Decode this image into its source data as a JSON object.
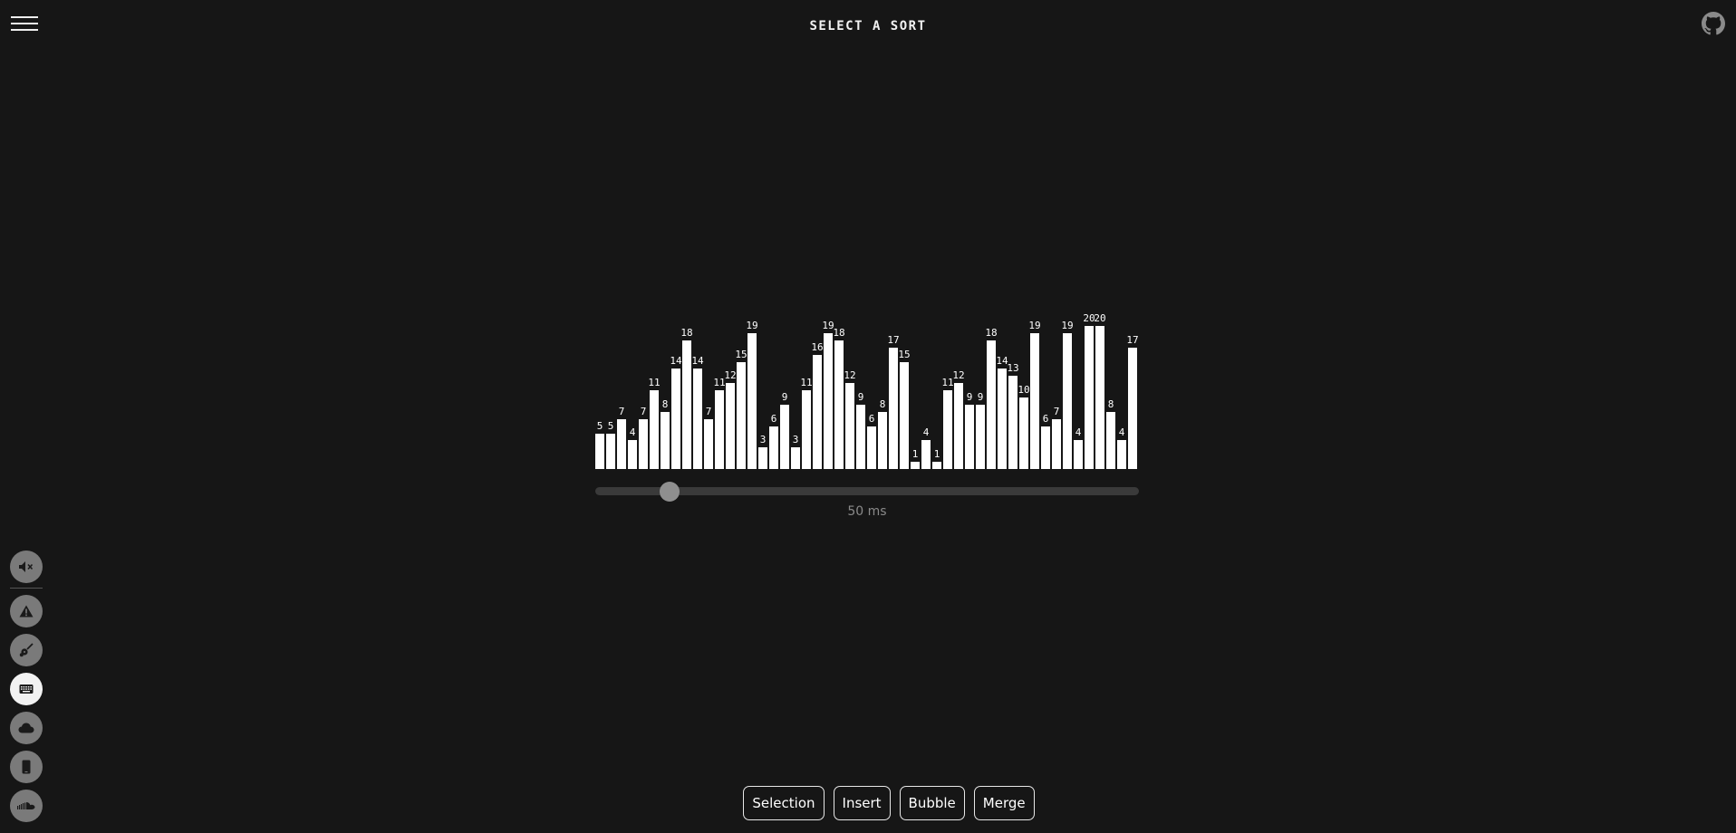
{
  "header": {
    "title": "SELECT A SORT",
    "menu_icon": "hamburger-menu-icon",
    "github_icon": "github-icon"
  },
  "visualizer": {
    "values": [
      5,
      5,
      7,
      4,
      7,
      11,
      8,
      14,
      18,
      14,
      7,
      11,
      12,
      15,
      19,
      3,
      6,
      9,
      3,
      11,
      16,
      19,
      18,
      12,
      9,
      6,
      8,
      17,
      15,
      1,
      4,
      1,
      11,
      12,
      9,
      9,
      18,
      14,
      13,
      10,
      19,
      6,
      7,
      19,
      4,
      20,
      20,
      8,
      4,
      17
    ],
    "max_value": 20
  },
  "speed": {
    "value_ms": 50,
    "label": "50 ms",
    "fraction": 0.137
  },
  "side_dock": {
    "buttons": [
      {
        "icon": "mute-icon",
        "active": false
      },
      {
        "icon": "warning-icon",
        "active": false
      },
      {
        "icon": "guitar-icon",
        "active": false
      },
      {
        "icon": "keyboard-icon",
        "active": true
      },
      {
        "icon": "cloud-icon",
        "active": false
      },
      {
        "icon": "phone-icon",
        "active": false
      },
      {
        "icon": "soundcloud-icon",
        "active": false
      }
    ]
  },
  "sort_buttons": {
    "selection": "Selection",
    "insert": "Insert",
    "bubble": "Bubble",
    "merge": "Merge"
  },
  "colors": {
    "background": "#161616",
    "bar": "#ffffff",
    "track": "#3a3a3a",
    "thumb": "#8f8f8f"
  }
}
